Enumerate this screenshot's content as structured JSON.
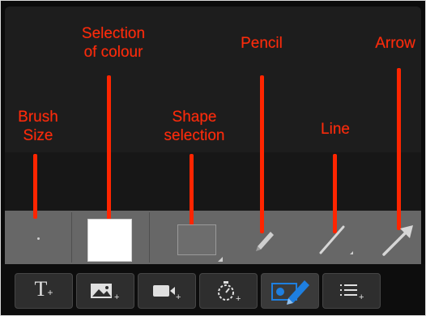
{
  "annotations": {
    "brush_size": "Brush\nSize",
    "selection_of_colour": "Selection\nof colour",
    "shape_selection": "Shape\nselection",
    "pencil": "Pencil",
    "line": "Line",
    "arrow": "Arrow"
  },
  "colors": {
    "annotation": "#ff2a0a",
    "selected_colour": "#ffffff",
    "active_tool_accent": "#1e7fe0"
  },
  "tool_strip": [
    {
      "name": "brush-size",
      "icon": "dot-icon"
    },
    {
      "name": "colour",
      "value": "#ffffff"
    },
    {
      "name": "shape",
      "icon": "rectangle-icon"
    },
    {
      "name": "pencil",
      "icon": "pencil-icon"
    },
    {
      "name": "line",
      "icon": "line-icon"
    },
    {
      "name": "arrow",
      "icon": "arrow-icon"
    }
  ],
  "toolbar": [
    {
      "name": "add-text",
      "icon": "text-plus-icon",
      "glyph": "T"
    },
    {
      "name": "add-image",
      "icon": "image-plus-icon"
    },
    {
      "name": "add-video",
      "icon": "video-plus-icon"
    },
    {
      "name": "add-timer",
      "icon": "stopwatch-plus-icon"
    },
    {
      "name": "draw",
      "icon": "draw-icon",
      "active": true
    },
    {
      "name": "add-list",
      "icon": "list-plus-icon"
    }
  ]
}
